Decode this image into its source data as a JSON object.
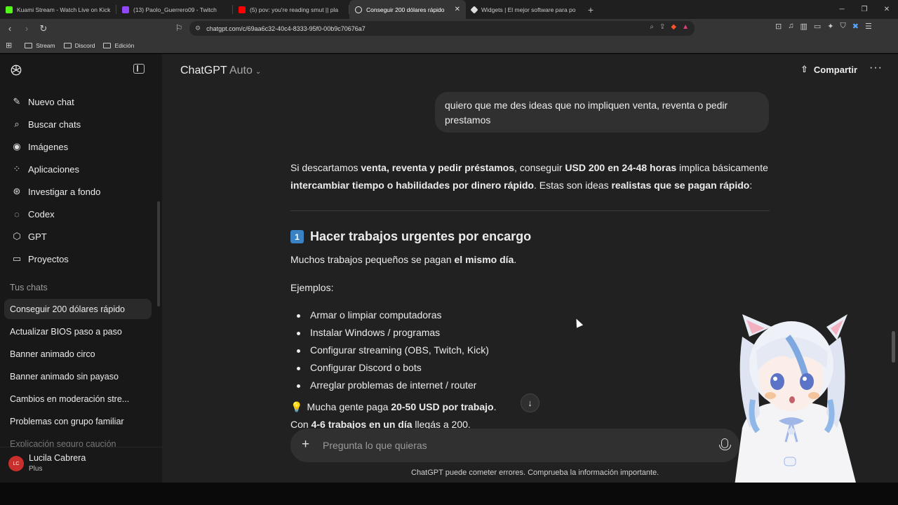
{
  "browser": {
    "tabs": [
      {
        "title": "Kuami Stream - Watch Live on Kick",
        "color": "#53fc18"
      },
      {
        "title": "(13) Paolo_Guerrero09 - Twitch",
        "color": "#9146ff"
      },
      {
        "title": "(5) pov: you're reading smut || pla",
        "color": "#ff0000"
      },
      {
        "title": "Conseguir 200 dólares rápido",
        "color": "#ececec"
      },
      {
        "title": "Widgets | El mejor software para po",
        "color": "#dddddd"
      }
    ],
    "url": "chatgpt.com/c/69aa6c32-40c4-8333-95f0-00b9c70676a7",
    "bookmarks": [
      "Stream",
      "Discord",
      "Edición"
    ]
  },
  "sidebar": {
    "nav": [
      {
        "label": "Nuevo chat",
        "icon": "edit-icon"
      },
      {
        "label": "Buscar chats",
        "icon": "search-icon"
      },
      {
        "label": "Imágenes",
        "icon": "image-icon"
      },
      {
        "label": "Aplicaciones",
        "icon": "apps-icon"
      },
      {
        "label": "Investigar a fondo",
        "icon": "research-icon"
      },
      {
        "label": "Codex",
        "icon": "codex-icon"
      },
      {
        "label": "GPT",
        "icon": "cube-icon"
      },
      {
        "label": "Proyectos",
        "icon": "folder-icon"
      }
    ],
    "section_label": "Tus chats",
    "chats": [
      "Conseguir 200 dólares rápido",
      "Actualizar BIOS paso a paso",
      "Banner animado circo",
      "Banner animado sin payaso",
      "Cambios en moderación stre...",
      "Problemas con grupo familiar",
      "Explicación seguro caución"
    ],
    "user": {
      "initials": "LC",
      "name": "Lucila Cabrera",
      "plan": "Plus"
    }
  },
  "header": {
    "model": "ChatGPT",
    "mode": "Auto",
    "share_label": "Compartir"
  },
  "conversation": {
    "user_message": "quiero que me des ideas que no impliquen venta, reventa o pedir prestamos",
    "intro": {
      "t1": "Si descartamos ",
      "b1": "venta, reventa y pedir préstamos",
      "t2": ", conseguir ",
      "b2": "USD 200 en 24-48 horas",
      "t3": " implica básicamente ",
      "b3": "intercambiar tiempo o habilidades por dinero rápido",
      "t4": ". Estas son ideas ",
      "b4": "realistas que se pagan rápido",
      "t5": ":"
    },
    "section_number": "1",
    "section_title": "Hacer trabajos urgentes por encargo",
    "lead": {
      "t1": "Muchos trabajos pequeños se pagan ",
      "b1": "el mismo día",
      "t2": "."
    },
    "examples_label": "Ejemplos:",
    "examples": [
      "Armar o limpiar computadoras",
      "Instalar Windows / programas",
      "Configurar streaming (OBS, Twitch, Kick)",
      "Configurar Discord o bots",
      "Arreglar problemas de internet / router"
    ],
    "tip": {
      "t1": "Mucha gente paga ",
      "b1": "20-50 USD por trabajo",
      "t2": "."
    },
    "tail": {
      "t1": "Con ",
      "b1": "4-6 trabajos en un día",
      "t2": " llegás a 200."
    }
  },
  "composer": {
    "placeholder": "Pregunta lo que quieras",
    "disclaimer": "ChatGPT puede cometer errores. Comprueba la información importante."
  }
}
